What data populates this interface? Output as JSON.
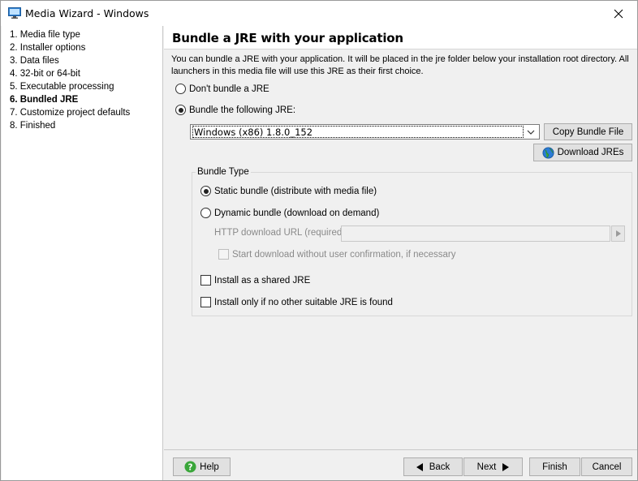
{
  "window": {
    "title": "Media Wizard - Windows"
  },
  "steps": [
    {
      "label": "1. Media file type"
    },
    {
      "label": "2. Installer options"
    },
    {
      "label": "3. Data files"
    },
    {
      "label": "4. 32-bit or 64-bit"
    },
    {
      "label": "5. Executable processing"
    },
    {
      "label": "6. Bundled JRE",
      "active": true
    },
    {
      "label": "7. Customize project defaults"
    },
    {
      "label": "8. Finished"
    }
  ],
  "main": {
    "title": "Bundle a JRE with your application",
    "description": "You can bundle a JRE with your application. It will be placed in the jre folder below your installation root directory. All launchers in this media file will use this JRE as their first choice.",
    "options": {
      "no_bundle": {
        "label": "Don't bundle a JRE",
        "checked": false
      },
      "bundle": {
        "label": "Bundle the following JRE:",
        "checked": true
      }
    },
    "jre_select": {
      "value": "Windows (x86) 1.8.0_152"
    },
    "copy_bundle_label": "Copy Bundle File",
    "download_jres_label": "Download JREs",
    "bundle_type": {
      "legend": "Bundle Type",
      "static": {
        "label": "Static bundle (distribute with media file)",
        "checked": true
      },
      "dynamic": {
        "label": "Dynamic bundle (download on demand)",
        "checked": false
      },
      "url_label": "HTTP download URL (required):",
      "url_value": "",
      "start_download_label": "Start download without user confirmation, if necessary",
      "shared_jre_label": "Install as a shared JRE",
      "only_if_none_label": "Install only if no other suitable JRE is found"
    }
  },
  "footer": {
    "help": "Help",
    "back": "Back",
    "next": "Next",
    "finish": "Finish",
    "cancel": "Cancel"
  },
  "colors": {
    "accent_green": "#3aa63a",
    "globe_blue": "#2b7bd6"
  }
}
